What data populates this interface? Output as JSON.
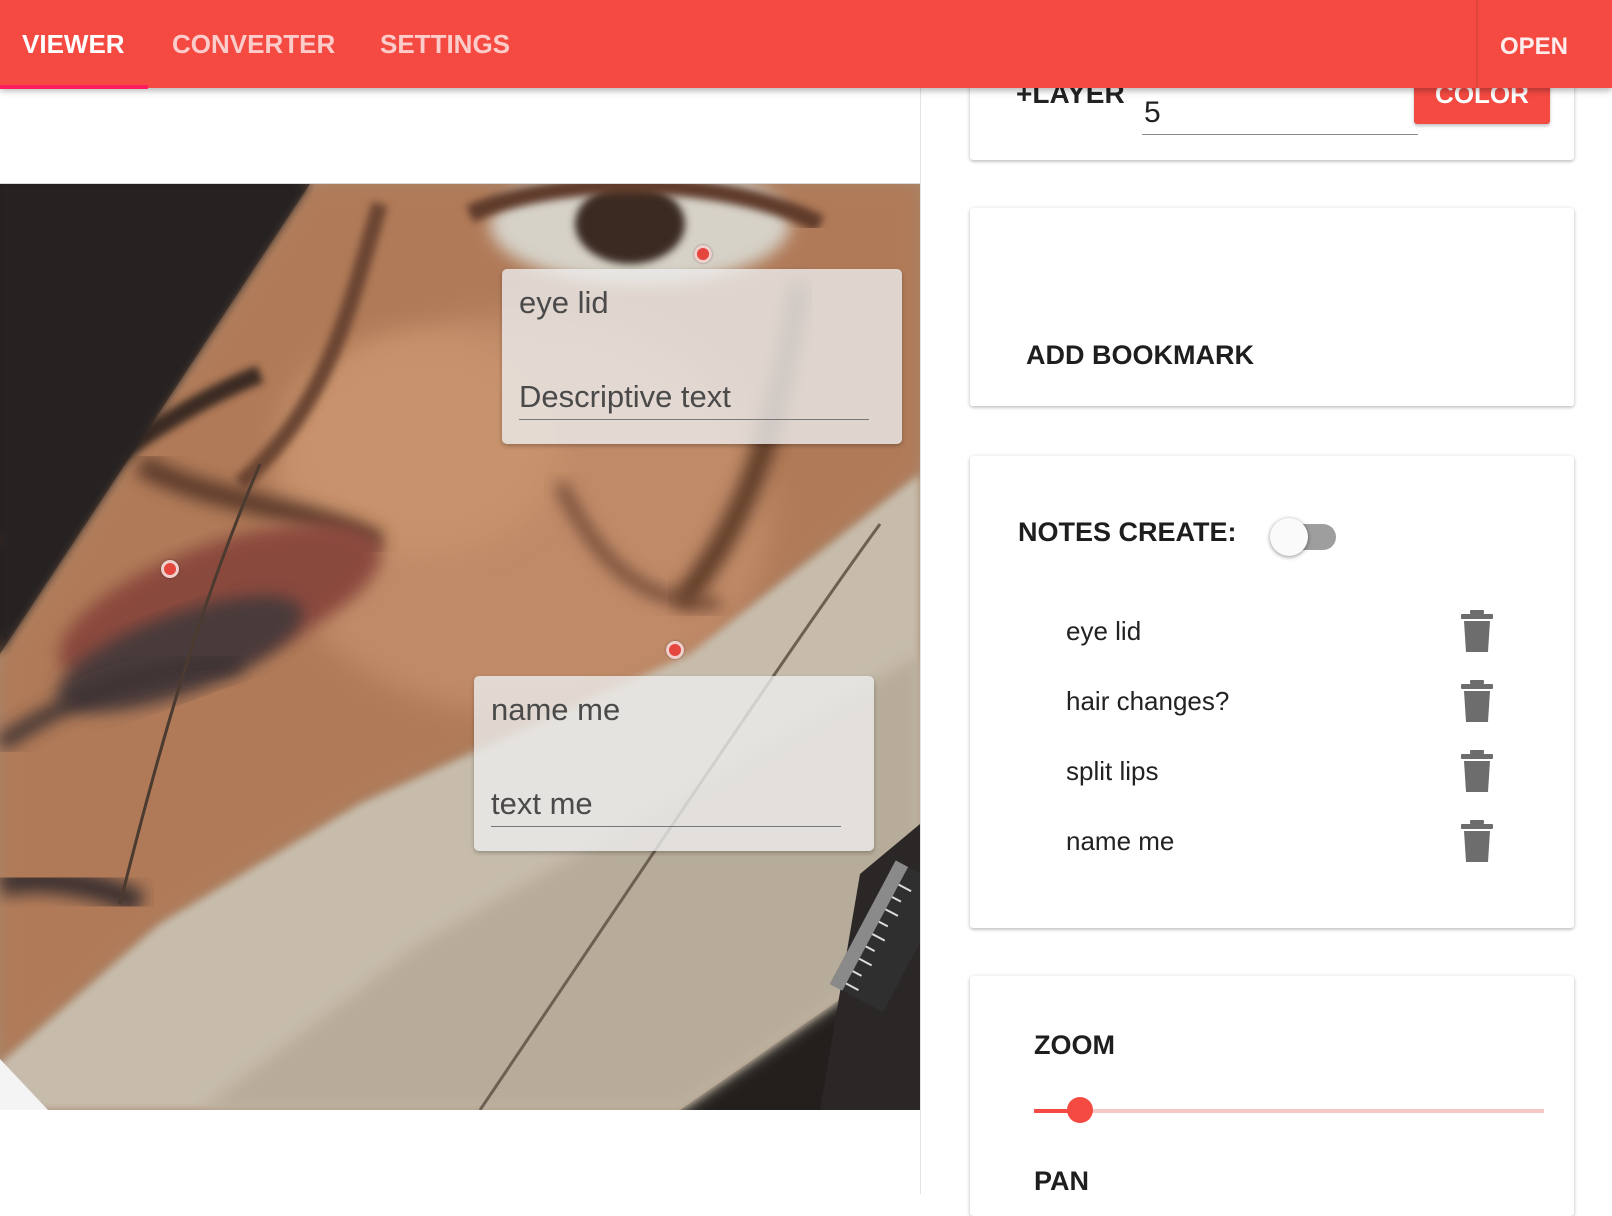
{
  "nav": {
    "tabs": [
      {
        "label": "VIEWER",
        "active": true
      },
      {
        "label": "CONVERTER",
        "active": false
      },
      {
        "label": "SETTINGS",
        "active": false
      }
    ],
    "open_label": "OPEN"
  },
  "viewer": {
    "annotations": [
      {
        "title": "eye lid",
        "text": "Descriptive text"
      },
      {
        "title": "name me",
        "text": "text me"
      }
    ]
  },
  "layer_card": {
    "label": "+LAYER",
    "value": "5",
    "color_button": "COLOR"
  },
  "bookmark_card": {
    "label": "ADD BOOKMARK"
  },
  "notes_card": {
    "label": "NOTES CREATE:",
    "toggle_on": false,
    "items": [
      {
        "label": "eye lid",
        "icon": "trash-icon"
      },
      {
        "label": "hair changes?",
        "icon": "trash-icon"
      },
      {
        "label": "split lips",
        "icon": "trash-icon"
      },
      {
        "label": "name me",
        "icon": "trash-icon"
      }
    ]
  },
  "controls_card": {
    "zoom_label": "ZOOM",
    "zoom_level": 0.09,
    "pan_label": "PAN"
  },
  "colors": {
    "accent": "#f44a42",
    "tab_indicator": "#ff1d5e"
  }
}
